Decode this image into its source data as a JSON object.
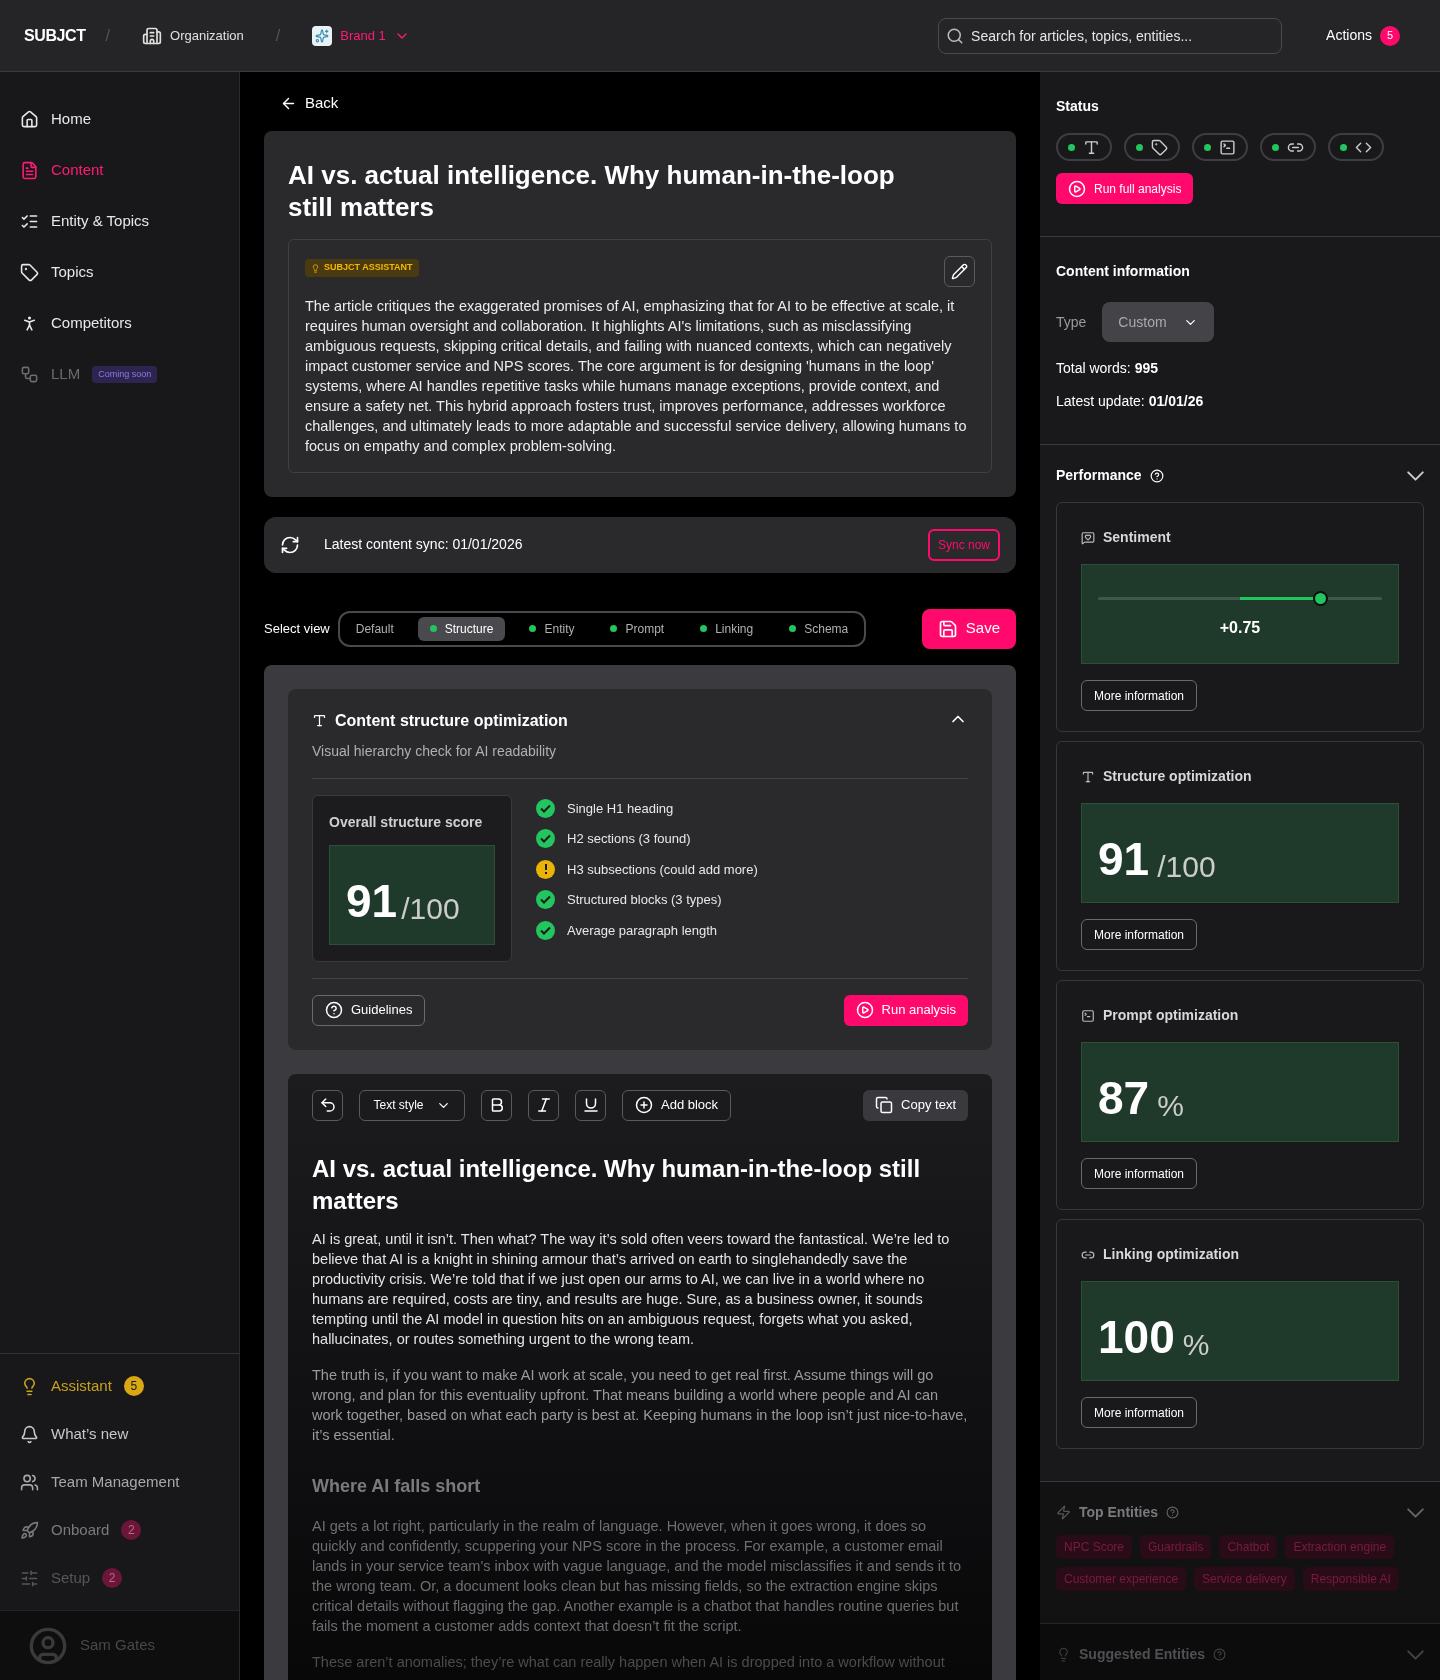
{
  "header": {
    "logo": "SUBJCT",
    "separators": [
      "/",
      "/"
    ],
    "organization": "Organization",
    "brand": "Brand 1",
    "search": {
      "placeholder": "Search for articles, topics, entities..."
    },
    "actions": {
      "label": "Actions",
      "count": "5"
    }
  },
  "sidebar": {
    "items": [
      {
        "kind": "home",
        "label": "Home",
        "selected": false,
        "disabled": false
      },
      {
        "kind": "content",
        "label": "Content",
        "selected": true,
        "disabled": false
      },
      {
        "kind": "entities",
        "label": "Entity & Topics",
        "selected": false,
        "disabled": false
      },
      {
        "kind": "topics",
        "label": "Topics",
        "selected": false,
        "disabled": false
      },
      {
        "kind": "competitors",
        "label": "Competitors",
        "selected": false,
        "disabled": false
      },
      {
        "kind": "llm",
        "label": "LLM",
        "selected": false,
        "disabled": true,
        "badge": "Coming soon"
      }
    ],
    "bottom_items": [
      {
        "kind": "assistant",
        "label": "Assistant",
        "badge": "5"
      },
      {
        "kind": "news",
        "label": "What’s new"
      },
      {
        "kind": "team",
        "label": "Team Management"
      },
      {
        "kind": "onboard",
        "label": "Onboard",
        "badge": "2"
      },
      {
        "kind": "setup",
        "label": "Setup",
        "badge": "2"
      }
    ],
    "user": {
      "name": "Sam Gates"
    }
  },
  "main": {
    "back": "Back",
    "title": "AI vs. actual intelligence. Why human-in-the-loop still matters",
    "assistant": {
      "badge": "SUBJCT ASSISTANT",
      "summary": "The article critiques the exaggerated promises of AI, emphasizing that for AI to be effective at scale, it requires human oversight and collaboration. It highlights AI's limitations, such as misclassifying ambiguous requests, skipping critical details, and failing with nuanced contexts, which can negatively impact customer service and NPS scores. The core argument is for designing 'humans in the loop' systems, where AI handles repetitive tasks while humans manage exceptions, provide context, and ensure a safety net. This hybrid approach fosters trust, improves performance, addresses workforce challenges, and ultimately leads to more adaptable and successful service delivery, allowing humans to focus on empathy and complex problem-solving."
    },
    "sync": {
      "text": "Latest content sync: 01/01/2026",
      "button": "Sync now"
    },
    "view": {
      "label": "Select view",
      "tabs": [
        {
          "label": "Default",
          "selected": false,
          "analyzed": false
        },
        {
          "label": "Structure",
          "selected": true,
          "analyzed": true
        },
        {
          "label": "Entity",
          "selected": false,
          "analyzed": true
        },
        {
          "label": "Prompt",
          "selected": false,
          "analyzed": true
        },
        {
          "label": "Linking",
          "selected": false,
          "analyzed": true
        },
        {
          "label": "Schema",
          "selected": false,
          "analyzed": true
        }
      ],
      "save": "Save"
    },
    "structure": {
      "title": "Content structure optimization",
      "subtitle": "Visual hierarchy check for AI readability",
      "expanded": true,
      "score_label": "Overall structure score",
      "score": "91",
      "score_unit": "/100",
      "checks": [
        {
          "label": "Single H1 heading",
          "passed": true
        },
        {
          "label": "H2 sections (3 found)",
          "passed": true
        },
        {
          "label": "H3 subsections (could add more)",
          "passed": false
        },
        {
          "label": "Structured blocks (3 types)",
          "passed": true
        },
        {
          "label": "Average paragraph length",
          "passed": true
        }
      ],
      "guidelines": "Guidelines",
      "run": "Run analysis"
    },
    "editor": {
      "toolbar": {
        "text_style": "Text style",
        "add_block": "Add block",
        "copy": "Copy text"
      },
      "blocks": [
        {
          "kind": "h1",
          "text": "AI vs. actual intelligence. Why human-in-the-loop still matters"
        },
        {
          "kind": "p",
          "text": "AI is great, until it isn’t. Then what? The way it’s sold often veers toward the fantastical. We’re led to believe that AI is a knight in shining armour that’s arrived on earth to singlehandedly save the productivity crisis. We’re told that if we just open our arms to AI, we can live in a world where no humans are required, costs are tiny, and results are huge. Sure, as a business owner, it sounds tempting until the AI model in question hits on an ambiguous request, forgets what you asked, hallucinates, or routes something urgent to the wrong team."
        },
        {
          "kind": "p",
          "text": "The truth is, if you want to make AI work at scale, you need to get real first. Assume things will go wrong, and plan for this eventuality upfront. That means building a world where people and AI can work together, based on what each party is best at. Keeping humans in the loop isn’t just nice-to-have, it’s essential."
        },
        {
          "kind": "h2",
          "text": "Where AI falls short"
        },
        {
          "kind": "p",
          "text": "AI gets a lot right, particularly in the realm of language. However, when it goes wrong, it does so quickly and confidently, scuppering your NPS score in the process. For example, a customer email lands in your service team's inbox with vague language, and the model misclassifies it and sends it to the wrong team. Or, a document looks clean but has missing fields, so the extraction engine skips critical details without flagging the gap. Another example is a chatbot that handles routine queries but fails the moment a customer adds context that doesn’t fit the script."
        },
        {
          "kind": "p",
          "text": "These aren’t anomalies; they’re what can really happen when AI is dropped into a workflow without"
        }
      ]
    }
  },
  "panel": {
    "status": {
      "title": "Status",
      "chips": [
        {
          "kind": "structure",
          "active": true
        },
        {
          "kind": "entity",
          "active": true
        },
        {
          "kind": "prompt",
          "active": true
        },
        {
          "kind": "linking",
          "active": true
        },
        {
          "kind": "schema",
          "active": true
        }
      ],
      "run": "Run full analysis"
    },
    "info": {
      "title": "Content information",
      "type_label": "Type",
      "type_value": "Custom",
      "words_label": "Total words:",
      "words": "995",
      "update_label": "Latest update:",
      "update": "01/01/26"
    },
    "performance": {
      "title": "Performance",
      "expanded": true,
      "cards": [
        {
          "kind": "slider",
          "title": "Sentiment",
          "value": "+0.75",
          "level": 0.78,
          "more": "More information"
        },
        {
          "kind": "score",
          "title": "Structure optimization",
          "value": "91",
          "unit": "/100",
          "more": "More information"
        },
        {
          "kind": "score",
          "title": "Prompt optimization",
          "value": "87",
          "unit": "%",
          "more": "More information"
        },
        {
          "kind": "score",
          "title": "Linking optimization",
          "value": "100",
          "unit": "%",
          "more": "More information"
        }
      ]
    },
    "top_entities": {
      "title": "Top Entities",
      "expanded": true,
      "tags": [
        "NPC Score",
        "Guardrails",
        "Chatbot",
        "Extraction engine",
        "Customer experience",
        "Service delivery",
        "Responsible AI"
      ]
    },
    "suggested": {
      "title": "Suggested Entities",
      "expanded": false
    }
  }
}
